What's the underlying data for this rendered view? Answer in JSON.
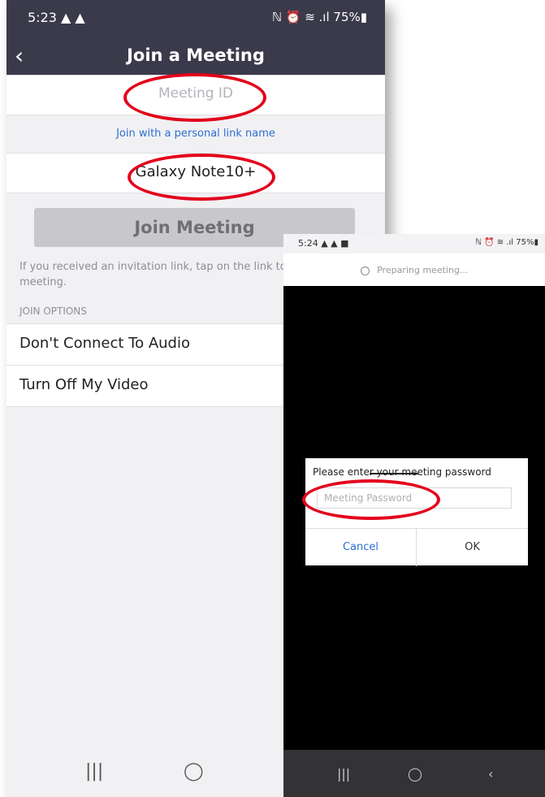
{
  "screen1": {
    "status": {
      "time": "5:23 ▲ ▲",
      "icons": "ℕ ⏰ ≋ .ıl 75%▮"
    },
    "header": {
      "back_icon": "‹",
      "title": "Join a Meeting"
    },
    "meeting_id": {
      "placeholder": "Meeting ID",
      "value": ""
    },
    "personal_link": "Join with a personal link name",
    "name_field": "Galaxy Note10+",
    "join_button": "Join Meeting",
    "invite_text": "If you received an invitation link, tap on the link to join the meeting.",
    "join_options_label": "JOIN OPTIONS",
    "options": [
      {
        "label": "Don't Connect To Audio"
      },
      {
        "label": "Turn Off My Video"
      }
    ],
    "navbar": {
      "recents": "|||",
      "home": "◯"
    }
  },
  "screen2": {
    "status": {
      "time": "5:24 ▲ ▲ ■",
      "icons": "ℕ ⏰ ≋ .ıl 75%▮"
    },
    "preparing_text": "Preparing meeting...",
    "dialog": {
      "title": "Please enter your meeting password",
      "password_placeholder": "Meeting Password",
      "cancel_label": "Cancel",
      "ok_label": "OK"
    },
    "navbar": {
      "recents": "|||",
      "home": "◯",
      "back": "‹"
    }
  },
  "colors": {
    "header_bg": "#3a3a4b",
    "link_blue": "#2d6fd3",
    "highlight_red": "#e3001b"
  }
}
